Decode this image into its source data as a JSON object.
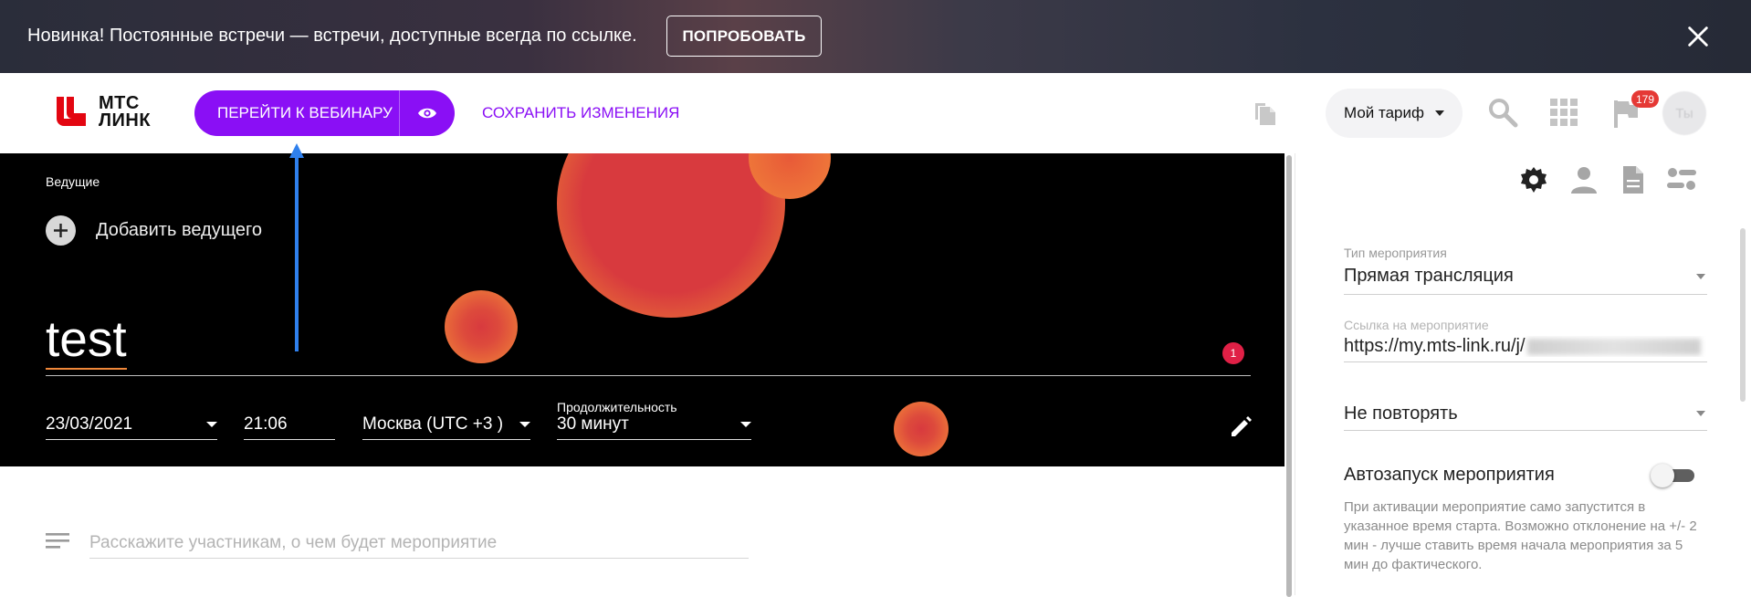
{
  "banner": {
    "text": "Новинка! Постоянные встречи — встречи, доступные всегда по ссылке.",
    "try_label": "ПОПРОБОВАТЬ"
  },
  "header": {
    "logo_line1": "МТС",
    "logo_line2": "ЛИНК",
    "webinar_label": "ПЕРЕЙТИ К ВЕБИНАРУ",
    "save_label": "СОХРАНИТЬ ИЗМЕНЕНИЯ",
    "tariff_label": "Мой тариф",
    "flag_badge": "179",
    "avatar_initials": "Ты"
  },
  "hero": {
    "hosts_label": "Ведущие",
    "add_host_label": "Добавить ведущего",
    "title": "test",
    "badge": "1",
    "date": "23/03/2021",
    "time": "21:06",
    "timezone": "Москва (UTC +3 )",
    "duration_label": "Продолжительность",
    "duration": "30 минут"
  },
  "description": {
    "placeholder": "Расскажите участникам, о чем будет мероприятие"
  },
  "settings": {
    "event_type_label": "Тип мероприятия",
    "event_type": "Прямая трансляция",
    "link_label": "Ссылка на мероприятие",
    "link_value": "https://my.mts-link.ru/j/",
    "repeat_value": "Не повторять",
    "autostart_label": "Автозапуск мероприятия",
    "autostart_enabled": false,
    "autostart_help": "При активации мероприятие само запустится в указанное время старта. Возможно отклонение на +/- 2 мин - лучше ставить время начала мероприятия за 5 мин до фактического."
  },
  "colors": {
    "accent": "#8a0ff5",
    "logo_red": "#e30611",
    "badge_red": "#e53935"
  }
}
